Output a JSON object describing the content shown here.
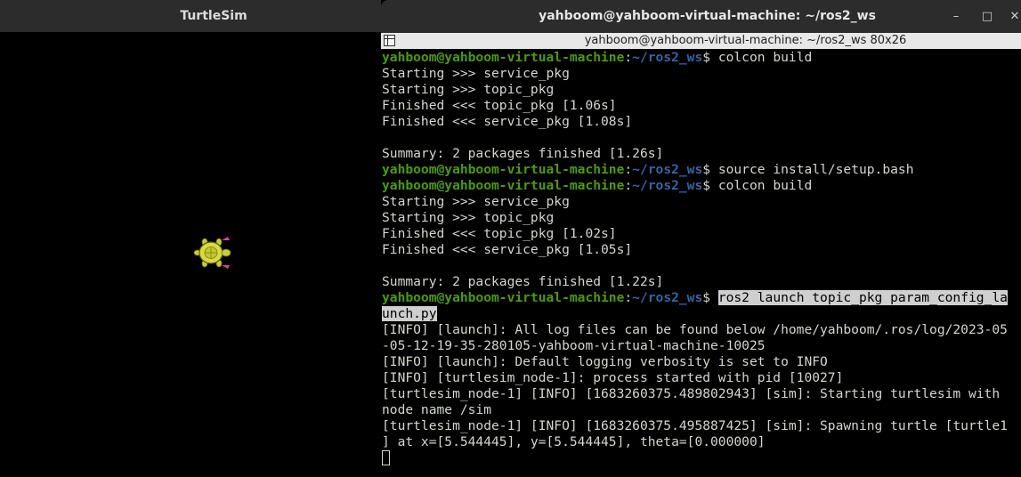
{
  "turtlesim": {
    "title": "TurtleSim"
  },
  "terminal": {
    "title": "yahboom@yahboom-virtual-machine: ~/ros2_ws",
    "subtitle": "yahboom@yahboom-virtual-machine: ~/ros2_ws 80x26",
    "buttons": {
      "minimize": "–",
      "maximize": "□",
      "close": "✕"
    },
    "prompt_user": "yahboom@yahboom-virtual-machine",
    "prompt_sep": ":",
    "prompt_path": "~/ros2_ws",
    "prompt_end": "$ ",
    "lines": {
      "l0": "colcon build",
      "l1": "Starting >>> service_pkg",
      "l2": "Starting >>> topic_pkg",
      "l3": "Finished <<< topic_pkg [1.06s]",
      "l4": "Finished <<< service_pkg [1.08s]",
      "l6": "Summary: 2 packages finished [1.26s]",
      "l7": "source install/setup.bash",
      "l8": "colcon build",
      "l9": "Starting >>> service_pkg",
      "l10": "Starting >>> topic_pkg",
      "l11": "Finished <<< topic_pkg [1.02s]",
      "l12": "Finished <<< service_pkg [1.05s]",
      "l14": "Summary: 2 packages finished [1.22s]",
      "l15": "ros2 launch topic_pkg param_config_la",
      "l16": "unch.py",
      "l17": "[INFO] [launch]: All log files can be found below /home/yahboom/.ros/log/2023-05",
      "l18": "-05-12-19-35-280105-yahboom-virtual-machine-10025",
      "l19": "[INFO] [launch]: Default logging verbosity is set to INFO",
      "l20": "[INFO] [turtlesim_node-1]: process started with pid [10027]",
      "l21": "[turtlesim_node-1] [INFO] [1683260375.489802943] [sim]: Starting turtlesim with",
      "l22": "node name /sim",
      "l23": "[turtlesim_node-1] [INFO] [1683260375.495887425] [sim]: Spawning turtle [turtle1",
      "l24": "] at x=[5.544445], y=[5.544445], theta=[0.000000]"
    }
  }
}
